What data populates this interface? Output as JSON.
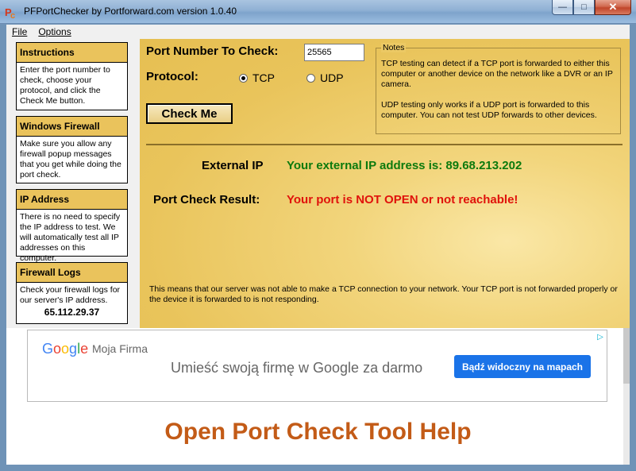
{
  "window": {
    "title": "PFPortChecker by Portforward.com version 1.0.40",
    "minimize": "—",
    "maximize": "□",
    "close": "✕"
  },
  "menu": {
    "file": "File",
    "options": "Options"
  },
  "sidebar": {
    "boxes": [
      {
        "heading": "Instructions",
        "body": "Enter the port number to check, choose your protocol, and click the Check Me button."
      },
      {
        "heading": "Windows Firewall",
        "body": "Make sure you allow any firewall popup messages that you get while doing the port check."
      },
      {
        "heading": "IP Address",
        "body": "There is no need to specify the IP address to test. We will automatically test all IP addresses on this computer."
      },
      {
        "heading": "Firewall Logs",
        "body": "Check your firewall logs for our server's IP address.",
        "server_ip": "65.112.29.37"
      }
    ]
  },
  "form": {
    "port_label": "Port Number To Check:",
    "port_value": "25565",
    "protocol_label": "Protocol:",
    "protocols": [
      {
        "label": "TCP",
        "selected": true
      },
      {
        "label": "UDP",
        "selected": false
      }
    ],
    "check_button": "Check Me"
  },
  "notes": {
    "legend": "Notes",
    "tcp_text": "TCP testing can detect if a TCP port is forwarded to either this computer or another device on the network like a DVR or an IP camera.",
    "udp_text": "UDP testing only works if a UDP port is forwarded to this computer. You can not test UDP forwards to other devices."
  },
  "results": {
    "external_ip_label": "External IP",
    "external_ip_value": "Your external IP address is: 89.68.213.202",
    "port_check_label": "Port Check Result:",
    "port_check_value": "Your port is NOT OPEN or not reachable!",
    "explanation": "This means that our server was not able to make a TCP connection to your network. Your TCP port is not forwarded properly or the device it is forwarded to is not responding."
  },
  "ad": {
    "logo": "Google",
    "brand": "Moja Firma",
    "headline": "Umieść swoją firmę w Google za darmo",
    "button": "Bądź widoczny na mapach",
    "ad_choice_icon": "adchoices-icon"
  },
  "help": {
    "heading": "Open Port Check Tool Help"
  },
  "colors": {
    "accent_gold": "#eac35c",
    "ok_green": "#0d7a0d",
    "error_red": "#e0120b",
    "heading_orange": "#c35b17",
    "ad_blue": "#1a73e8"
  }
}
